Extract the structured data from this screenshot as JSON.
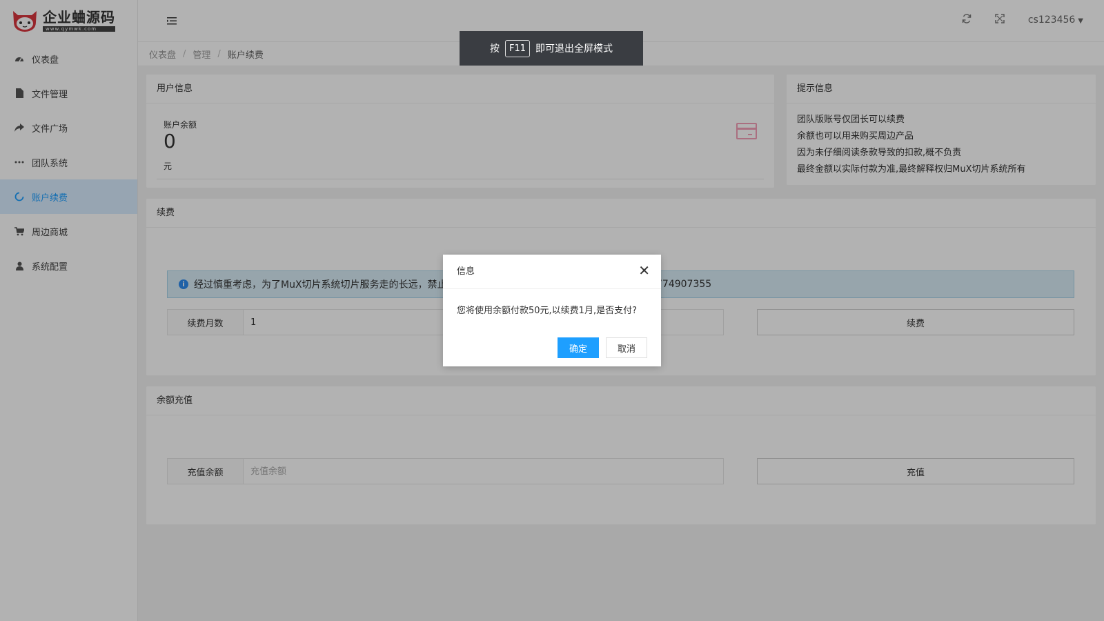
{
  "brand": {
    "title": "企业蛐源码",
    "subtitle": "www.qymwk.com"
  },
  "sidebar": {
    "items": [
      {
        "label": "仪表盘",
        "icon": "dashboard-icon"
      },
      {
        "label": "文件管理",
        "icon": "file-icon"
      },
      {
        "label": "文件广场",
        "icon": "share-icon"
      },
      {
        "label": "团队系统",
        "icon": "more-icon"
      },
      {
        "label": "账户续费",
        "icon": "refresh-icon",
        "active": true
      },
      {
        "label": "周边商城",
        "icon": "cart-icon"
      },
      {
        "label": "系统配置",
        "icon": "user-icon"
      }
    ]
  },
  "header": {
    "username": "cs123456"
  },
  "breadcrumb": {
    "items": [
      "仪表盘",
      "管理",
      "账户续费"
    ]
  },
  "fullscreen_hint": {
    "prefix": "按",
    "key": "F11",
    "suffix": "即可退出全屏模式"
  },
  "user_info": {
    "title": "用户信息",
    "balance_label": "账户余额",
    "balance_value": "0",
    "balance_unit": "元"
  },
  "tips": {
    "title": "提示信息",
    "lines": [
      "团队版账号仅团长可以续费",
      "余额也可以用来购买周边产品",
      "因为未仔细阅读条款导致的扣款,概不负责",
      "最终金额以实际付款为准,最终解释权归MuX切片系统所有"
    ]
  },
  "renew": {
    "title": "续费",
    "notice_text": "经过慎重考虑，为了MuX切片系统切片服务走的长远，禁止",
    "notice_tail": "774907355",
    "months_label": "续费月数",
    "months_value": "1",
    "button": "续费"
  },
  "recharge": {
    "title": "余额充值",
    "amount_label": "充值余额",
    "amount_placeholder": "充值余额",
    "button": "充值"
  },
  "dialog": {
    "title": "信息",
    "message": "您将使用余额付款50元,以续费1月,是否支付?",
    "confirm": "确定",
    "cancel": "取消"
  },
  "colors": {
    "accent": "#1e9fff",
    "active_bg": "#d9ecff",
    "notice_bg": "#d9edf7",
    "card_icon": "#f4a0b8"
  }
}
